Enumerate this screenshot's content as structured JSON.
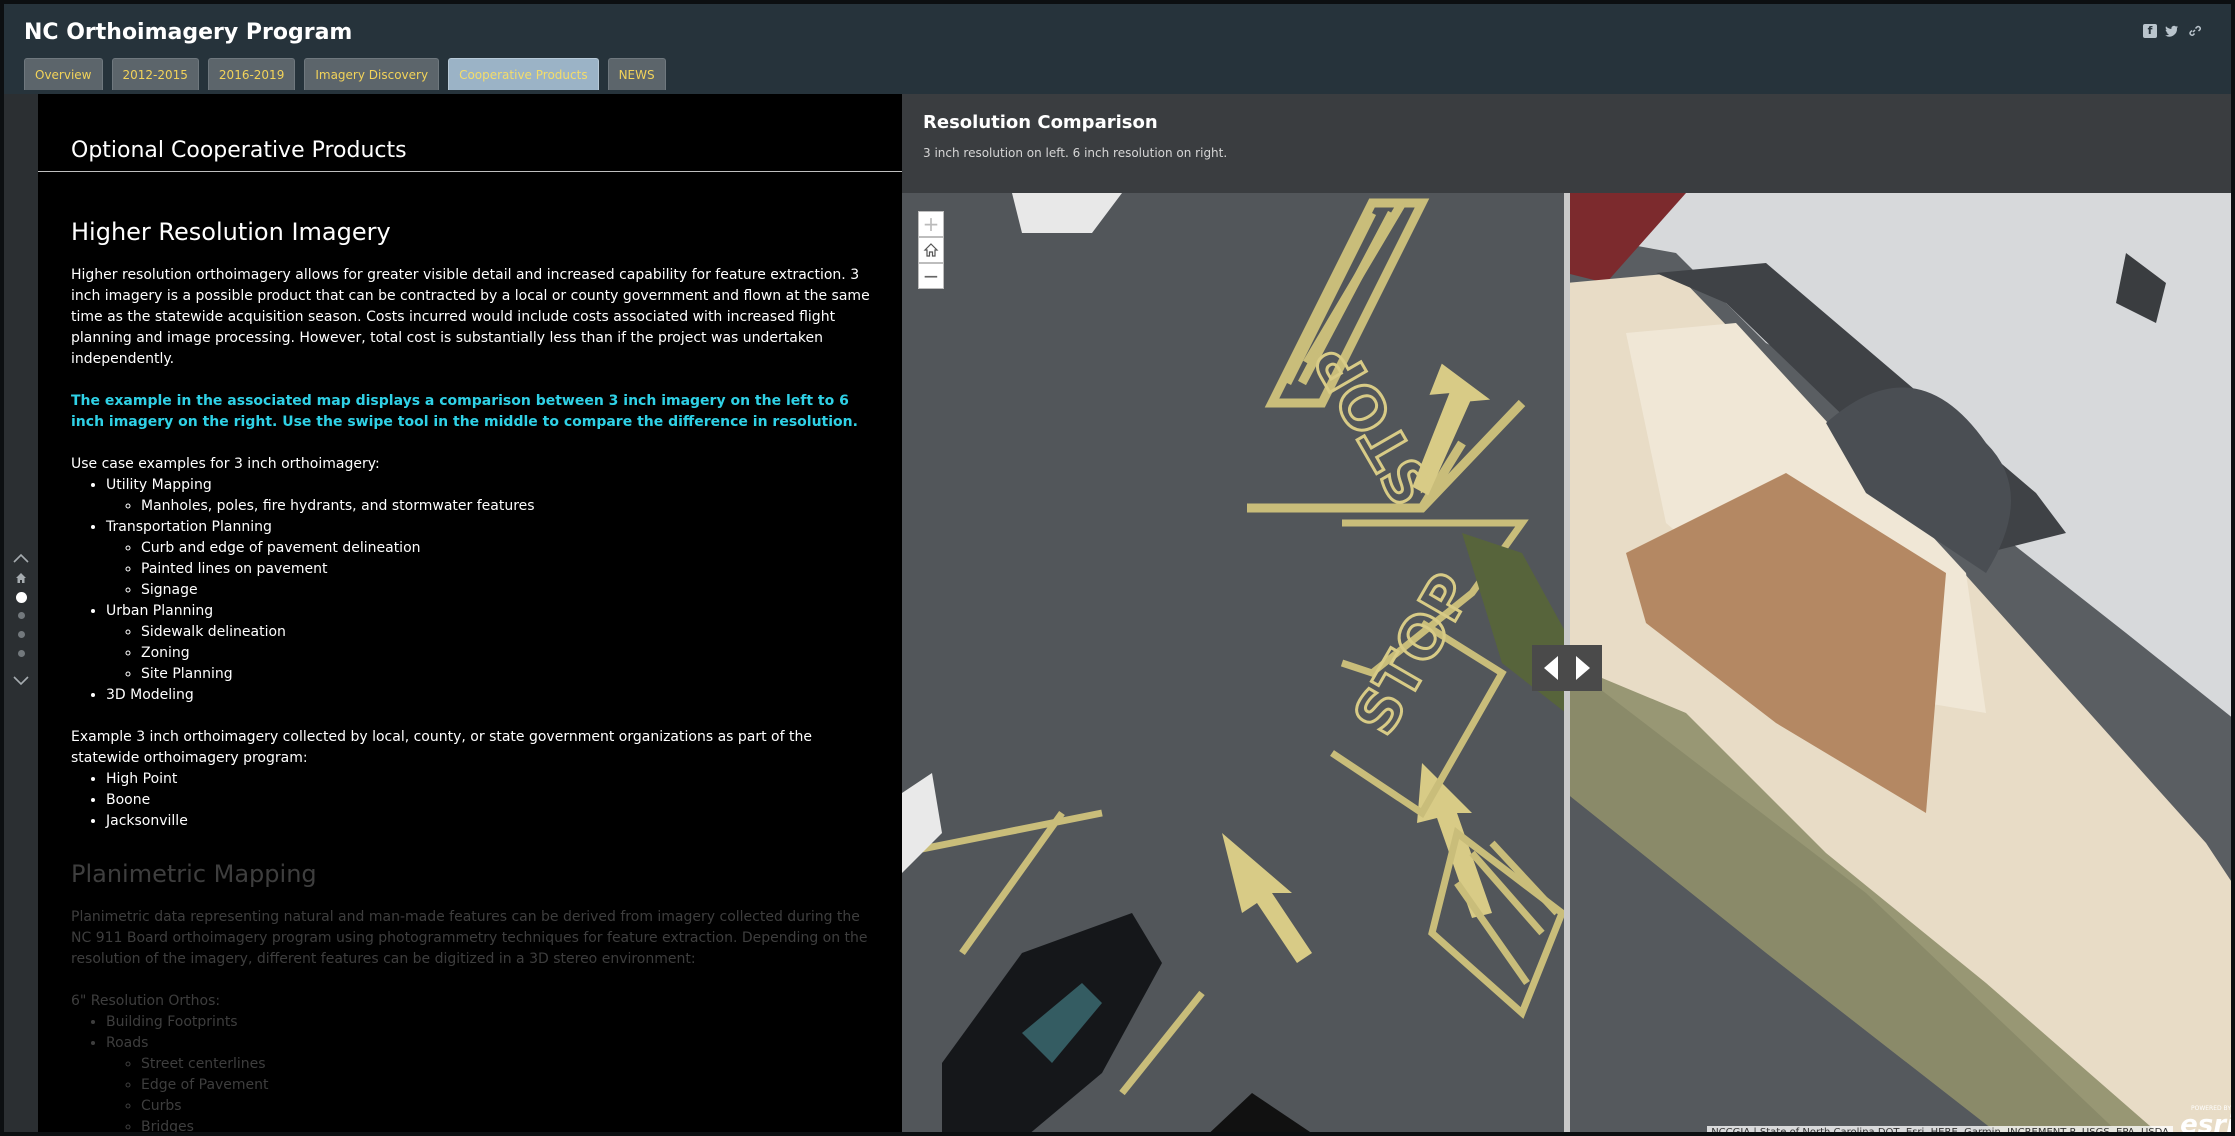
{
  "app": {
    "title": "NC Orthoimagery Program",
    "social_icons": [
      "facebook-icon",
      "twitter-icon",
      "link-icon"
    ]
  },
  "tabs": [
    {
      "label": "Overview",
      "active": false
    },
    {
      "label": "2012-2015",
      "active": false
    },
    {
      "label": "2016-2019",
      "active": false
    },
    {
      "label": "Imagery Discovery",
      "active": false
    },
    {
      "label": "Cooperative Products",
      "active": true
    },
    {
      "label": "NEWS",
      "active": false
    }
  ],
  "nav": {
    "icons": [
      "chevron-up-icon",
      "home-icon",
      "chevron-down-icon"
    ],
    "dot_count": 4,
    "current_dot": 0
  },
  "narrative": {
    "section_title": "Optional Cooperative Products",
    "higher_res": {
      "heading": "Higher Resolution Imagery",
      "intro": "Higher resolution orthoimagery allows for greater visible detail and increased capability for feature extraction. 3 inch imagery is a possible product that can be contracted by a local or county government and flown at the same time as the statewide acquisition season. Costs incurred would include costs associated with increased flight planning and image processing. However, total cost is substantially less than if the project was undertaken independently.",
      "highlight": "The example in the associated map displays a comparison between 3 inch imagery on the left to 6 inch imagery on the right. Use the swipe tool in the middle to compare the difference in resolution.",
      "use_case_lead": "Use case examples for 3 inch orthoimagery:",
      "use_cases": [
        {
          "label": "Utility Mapping",
          "sub": [
            "Manholes, poles, fire hydrants, and stormwater features"
          ]
        },
        {
          "label": "Transportation Planning",
          "sub": [
            "Curb and edge of pavement delineation",
            "Painted lines on pavement",
            "Signage"
          ]
        },
        {
          "label": "Urban Planning",
          "sub": [
            "Sidewalk delineation",
            "Zoning",
            "Site Planning"
          ]
        },
        {
          "label": "3D Modeling",
          "sub": []
        }
      ],
      "examples_lead": "Example 3 inch orthoimagery collected by local, county, or state government organizations as part of the statewide orthoimagery program:",
      "examples": [
        "High Point",
        "Boone",
        "Jacksonville"
      ]
    },
    "planimetric": {
      "heading": "Planimetric Mapping",
      "intro": "Planimetric data representing natural and man-made features can be derived from imagery collected during the NC 911 Board orthoimagery program using photogrammetry techniques for feature extraction. Depending on the resolution of the imagery, different features can be digitized in a 3D stereo environment:",
      "lead": "6\" Resolution Orthos:",
      "items": [
        {
          "label": "Building Footprints",
          "sub": []
        },
        {
          "label": "Roads",
          "sub": [
            "Street centerlines",
            "Edge of Pavement",
            "Curbs",
            "Bridges"
          ]
        }
      ]
    }
  },
  "map": {
    "title": "Resolution Comparison",
    "subtitle": "3 inch resolution on left. 6 inch resolution on right.",
    "zoom_controls": [
      "zoom-in-icon",
      "home-icon",
      "zoom-out-icon"
    ],
    "attribution": "NCCGIA | State of North Carolina DOT, Esri, HERE, Garmin, INCREMENT P, USGS, EPA, USDA",
    "logo_caption": "POWERED BY",
    "logo_text": "esri",
    "swipe_position": 0.497
  },
  "colors": {
    "header_bg": "#26333b",
    "tab_text": "#f2d35a",
    "active_tab_bg": "#9bb3c6",
    "highlight_text": "#2fd1e6",
    "narrative_bg": "#000000",
    "map_panel_bg": "#3a3d40"
  }
}
